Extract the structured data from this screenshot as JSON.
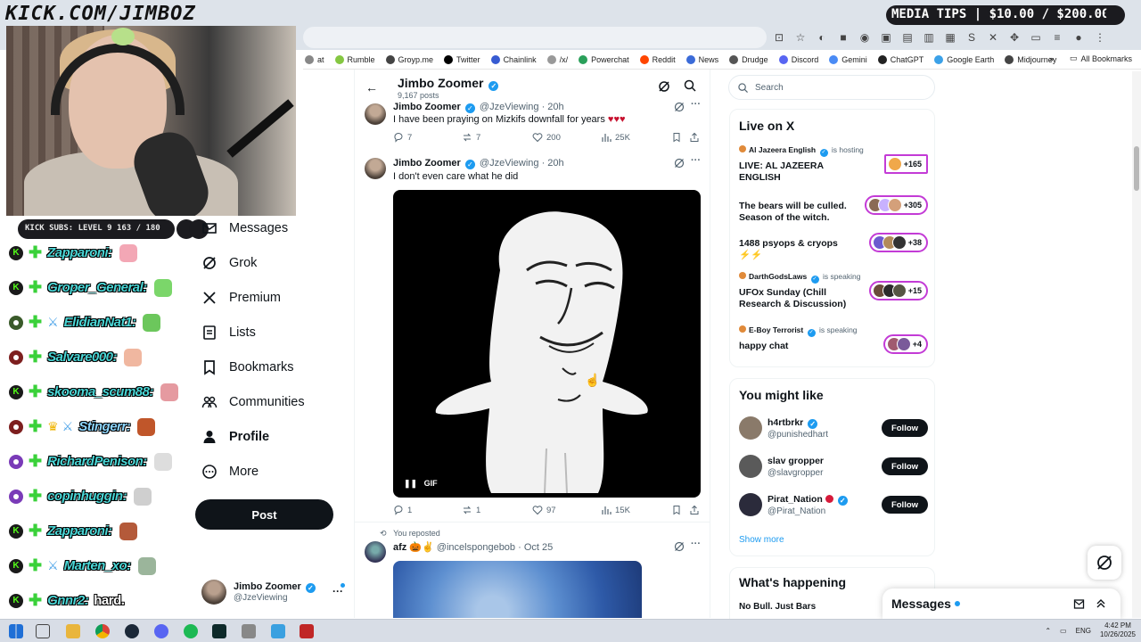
{
  "overlay": {
    "url_title": "KICK.COM/JIMBOZ",
    "media_tips": "MEDIA TIPS | $10.00 / $200.00",
    "subs": "KICK SUBS: LEVEL 9 163 / 180"
  },
  "bookmarks": [
    {
      "label": "at",
      "color": "#888"
    },
    {
      "label": "Rumble",
      "color": "#85c742"
    },
    {
      "label": "Groyp.me",
      "color": "#444"
    },
    {
      "label": "Twitter",
      "color": "#000"
    },
    {
      "label": "Chainlink",
      "color": "#375bd2"
    },
    {
      "label": "/x/",
      "color": "#999"
    },
    {
      "label": "Powerchat",
      "color": "#2aa05a"
    },
    {
      "label": "Reddit",
      "color": "#ff4500"
    },
    {
      "label": "News",
      "color": "#3b6bd8"
    },
    {
      "label": "Drudge",
      "color": "#555"
    },
    {
      "label": "Discord",
      "color": "#5865f2"
    },
    {
      "label": "Gemini",
      "color": "#4a8bf5"
    },
    {
      "label": "ChatGPT",
      "color": "#222"
    },
    {
      "label": "Google Earth",
      "color": "#3ba1e8"
    },
    {
      "label": "Midjourney",
      "color": "#444"
    }
  ],
  "all_bookmarks": "All Bookmarks",
  "chat": [
    {
      "badge": "k",
      "name": "Zapparoni:",
      "color": "c-teal",
      "emote": "#f3a7b5"
    },
    {
      "badge": "k",
      "name": "Groper_General:",
      "color": "c-teal",
      "emote": "#7bd66a"
    },
    {
      "badge": "o-green",
      "name": "ElidianNat1:",
      "color": "c-teal",
      "emote": "#6cc75c",
      "sword": true
    },
    {
      "badge": "o",
      "name": "Salvare000:",
      "color": "c-teal",
      "emote": "#f0b7a0"
    },
    {
      "badge": "k",
      "name": "skooma_scum88:",
      "color": "c-teal",
      "emote": "#e59aa0"
    },
    {
      "badge": "o",
      "name": "Stingerr:",
      "color": "c-lblue",
      "emote": "#c0562a",
      "crown": true,
      "sword": true
    },
    {
      "badge": "o-purple",
      "name": "RichardPenison:",
      "color": "c-teal",
      "emote": "#dddddd"
    },
    {
      "badge": "o-purple",
      "name": "copinhuggin:",
      "color": "c-teal",
      "emote": "#cfcfcf"
    },
    {
      "badge": "k",
      "name": "Zapparoni:",
      "color": "c-teal",
      "emote": "#b45a3a"
    },
    {
      "badge": "k",
      "name": "Marten_xo:",
      "color": "c-teal",
      "emote": "#9bb59b",
      "sword": true
    },
    {
      "badge": "k",
      "name": "Gnnr2:",
      "color": "c-teal",
      "text": "hard."
    }
  ],
  "nav": [
    {
      "label": "Messages",
      "icon": "mail-icon"
    },
    {
      "label": "Grok",
      "icon": "grok-icon"
    },
    {
      "label": "Premium",
      "icon": "x-logo-icon"
    },
    {
      "label": "Lists",
      "icon": "lists-icon"
    },
    {
      "label": "Bookmarks",
      "icon": "bookmark-icon"
    },
    {
      "label": "Communities",
      "icon": "communities-icon"
    },
    {
      "label": "Profile",
      "icon": "profile-icon",
      "bold": true
    },
    {
      "label": "More",
      "icon": "more-circle-icon"
    }
  ],
  "post_button": "Post",
  "account": {
    "name": "Jimbo Zoomer",
    "handle": "@JzeViewing"
  },
  "header": {
    "name": "Jimbo Zoomer",
    "posts": "9,167 posts"
  },
  "tweets": [
    {
      "name": "Jimbo Zoomer",
      "handle": "@JzeViewing · 20h",
      "text": "I have been praying on Mizkifs downfall for years",
      "hearts": "♥♥♥",
      "replies": "7",
      "reposts": "7",
      "likes": "200",
      "views": "25K"
    },
    {
      "name": "Jimbo Zoomer",
      "handle": "@JzeViewing · 20h",
      "text": "I don't even care what he did",
      "gif_label": "GIF",
      "replies": "1",
      "reposts": "1",
      "likes": "97",
      "views": "15K"
    },
    {
      "repost_label": "You reposted",
      "name": "afz",
      "handle": "@incelspongebob · Oct 25"
    }
  ],
  "search_placeholder": "Search",
  "live": {
    "title": "Live on X",
    "items": [
      {
        "host": "Al Jazeera English",
        "status": "is hosting",
        "title": "LIVE: AL JAZEERA ENGLISH",
        "count": "+165"
      },
      {
        "host": "",
        "status": "",
        "title": "The bears will be culled. Season of the witch.",
        "count": "+305"
      },
      {
        "host": "",
        "status": "",
        "title": "1488 psyops & cryops ⚡⚡",
        "count": "+38"
      },
      {
        "host": "DarthGodsLaws",
        "status": "is speaking",
        "title": "UFOx Sunday (Chill Research & Discussion)",
        "count": "+15"
      },
      {
        "host": "E-Boy Terrorist",
        "status": "is speaking",
        "title": "happy chat",
        "count": "+4"
      }
    ]
  },
  "might_like": {
    "title": "You might like",
    "users": [
      {
        "name": "h4rtbrkr",
        "handle": "@punishedhart",
        "avatar": "#8a7a6a"
      },
      {
        "name": "slav gropper",
        "handle": "@slavgropper",
        "avatar": "#5a5a5a"
      },
      {
        "name": "Pirat_Nation",
        "handle": "@Pirat_Nation",
        "avatar": "#2b2b3b"
      }
    ],
    "follow_label": "Follow",
    "show_more": "Show more"
  },
  "happening": {
    "title": "What's happening",
    "item": "No Bull. Just Bars"
  },
  "messages_dock": "Messages",
  "taskbar": {
    "lang": "ENG",
    "time": "4:42 PM",
    "date": "10/26/2025"
  }
}
